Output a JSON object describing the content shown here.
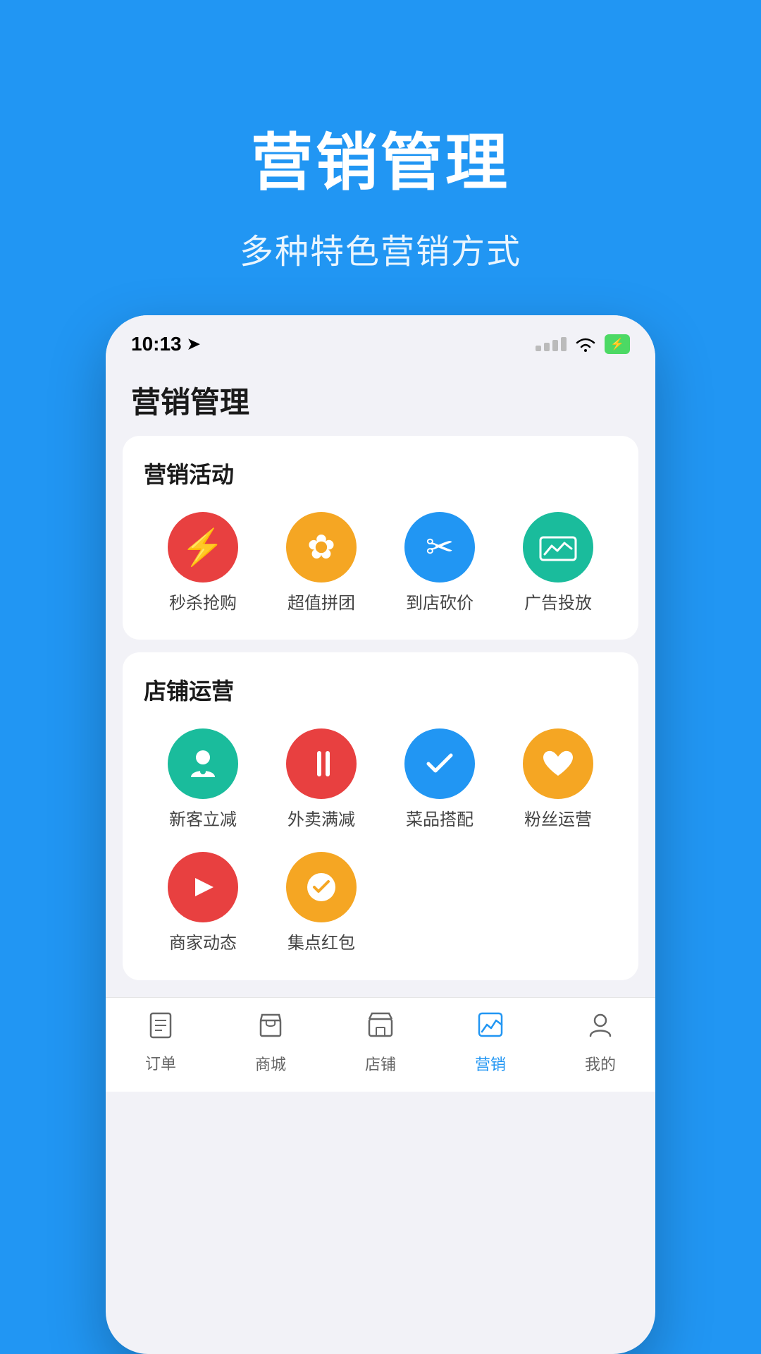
{
  "hero": {
    "title": "营销管理",
    "subtitle": "多种特色营销方式"
  },
  "statusBar": {
    "time": "10:13",
    "locationArrow": "➤"
  },
  "appHeader": {
    "title": "营销管理"
  },
  "marketingActivities": {
    "sectionTitle": "营销活动",
    "items": [
      {
        "label": "秒杀抢购",
        "bgColor": "#e84040",
        "icon": "⚡"
      },
      {
        "label": "超值拼团",
        "bgColor": "#f5a623",
        "icon": "✿"
      },
      {
        "label": "到店砍价",
        "bgColor": "#2196f3",
        "icon": "✂"
      },
      {
        "label": "广告投放",
        "bgColor": "#1abc9c",
        "icon": "📊"
      }
    ]
  },
  "storeOperations": {
    "sectionTitle": "店铺运营",
    "items": [
      {
        "label": "新客立减",
        "bgColor": "#1abc9c",
        "icon": "👤"
      },
      {
        "label": "外卖满减",
        "bgColor": "#e84040",
        "icon": "🍴"
      },
      {
        "label": "菜品搭配",
        "bgColor": "#2196f3",
        "icon": "👍"
      },
      {
        "label": "粉丝运营",
        "bgColor": "#f5a623",
        "icon": "♥"
      },
      {
        "label": "商家动态",
        "bgColor": "#e84040",
        "icon": "▶"
      },
      {
        "label": "集点红包",
        "bgColor": "#f5a623",
        "icon": "✓"
      }
    ]
  },
  "bottomNav": {
    "items": [
      {
        "label": "订单",
        "icon": "☰",
        "active": false
      },
      {
        "label": "商城",
        "icon": "🛍",
        "active": false
      },
      {
        "label": "店铺",
        "icon": "🖥",
        "active": false
      },
      {
        "label": "营销",
        "icon": "📈",
        "active": true
      },
      {
        "label": "我的",
        "icon": "👤",
        "active": false
      }
    ]
  }
}
